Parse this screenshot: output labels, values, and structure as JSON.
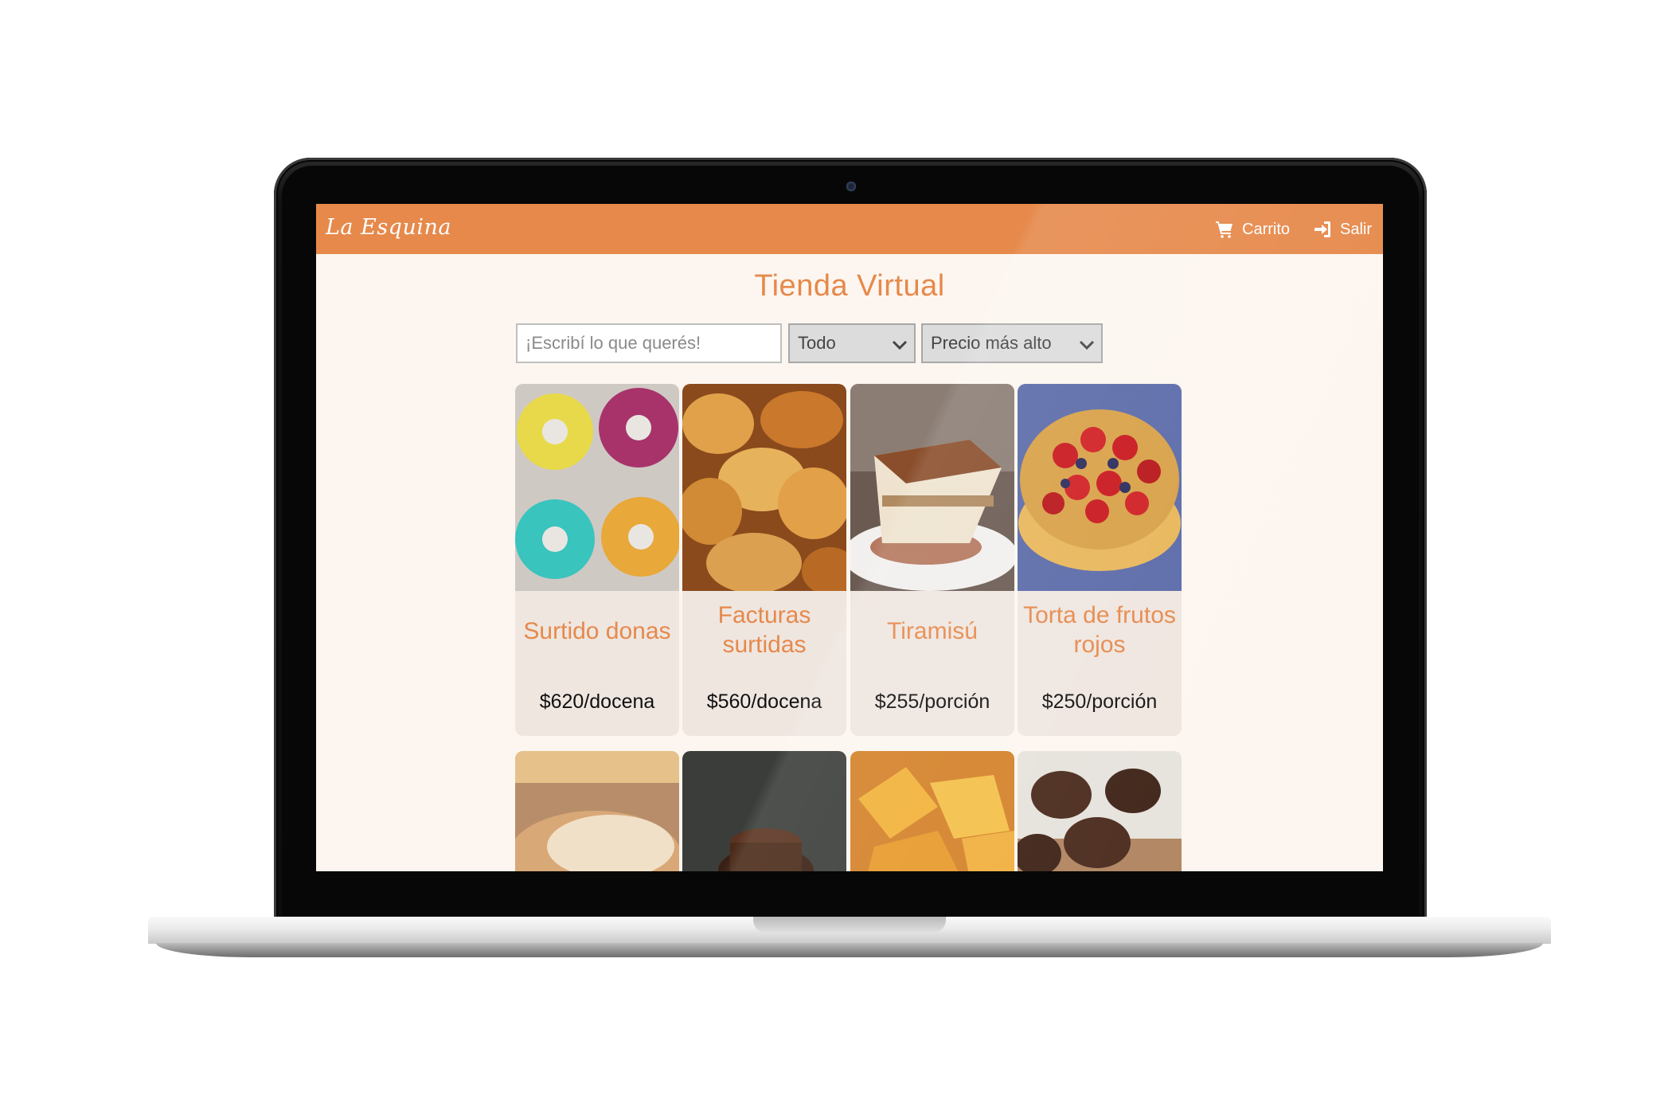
{
  "navbar": {
    "brand": "La Esquina",
    "cart_label": "Carrito",
    "exit_label": "Salir",
    "color": "#e6894b"
  },
  "main": {
    "title": "Tienda Virtual",
    "search": {
      "placeholder": "¡Escribí lo que querés!",
      "value": ""
    },
    "category_filter": {
      "selected": "Todo"
    },
    "sort_filter": {
      "selected": "Precio más alto"
    }
  },
  "products": [
    {
      "name": "Surtido donas",
      "price": "$620/docena",
      "image": "donuts"
    },
    {
      "name": "Facturas surtidas",
      "price": "$560/docena",
      "image": "pastries"
    },
    {
      "name": "Tiramisú",
      "price": "$255/porción",
      "image": "tiramisu"
    },
    {
      "name": "Torta de frutos rojos",
      "price": "$250/porción",
      "image": "berry-tart"
    },
    {
      "name": "",
      "price": "",
      "image": "lemon-pie"
    },
    {
      "name": "",
      "price": "",
      "image": "chocolate-cake"
    },
    {
      "name": "",
      "price": "",
      "image": "fried-pastries"
    },
    {
      "name": "",
      "price": "",
      "image": "chocolate-muffins"
    }
  ],
  "colors": {
    "accent": "#e6894b",
    "background": "#fdf6f0",
    "card": "#efe6e0"
  }
}
